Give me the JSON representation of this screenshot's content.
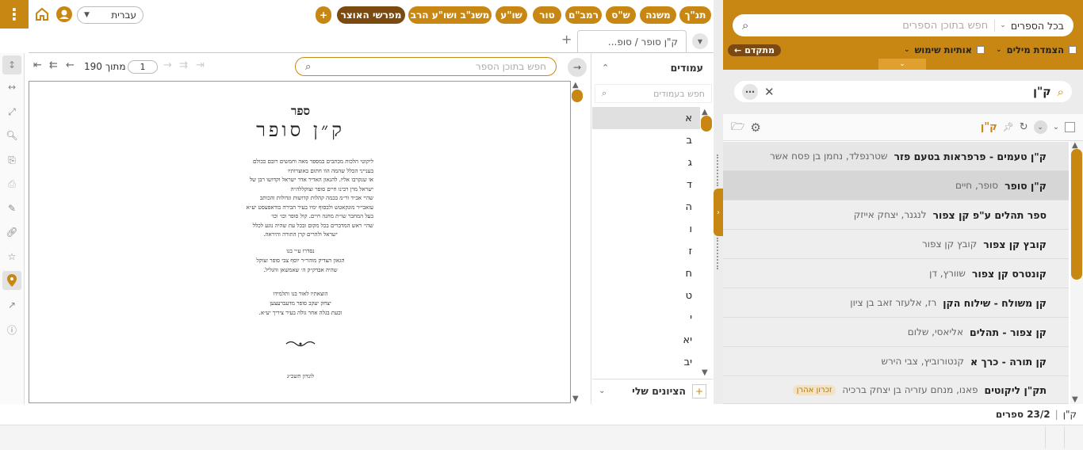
{
  "toolbar": {
    "tabs": [
      "תנ\"ך",
      "משנה",
      "ש\"ס",
      "רמב\"ם",
      "טור",
      "שו\"ע",
      "משנ\"ב ושו\"ע הרב",
      "מפרשי האוצר"
    ],
    "add": "+",
    "language": "עברית"
  },
  "doc_tab": {
    "title": "ק\"ן סופר / סופ..."
  },
  "nav": {
    "page_value": "1",
    "page_total": "מתוך 190",
    "search_placeholder": "חפש בתוכן הספר"
  },
  "pages_panel": {
    "title": "עמודים",
    "search_placeholder": "חפש בעמודים",
    "letters": [
      "א",
      "ב",
      "ג",
      "ד",
      "ה",
      "ו",
      "ז",
      "ח",
      "ט",
      "י",
      "יא",
      "יב"
    ],
    "bookmarks": "הציונים שלי"
  },
  "book_page": {
    "word_sefer": "ספר",
    "title": "ק״ן סופר",
    "p1": "ליקוטי הלכות מכתבים במספר מאה וחמשים רובם ככולם",
    "p2": "בענייני הכלל שהמה הוו חתום באוצרותיו",
    "p3": "או שנקרבו אליו. להגאון האדיר אדר ישראל וקדושו רבן של",
    "p4": "ישראל מרן רבינו חיים סופר זצוקללה״ה",
    "p5": "שהיי אב״ד ור״מ בכמה קהלות קדושות וגדולות והכותב",
    "p6": "עזאבי״ר מונקאטש ולבסוף ימיו בעיר הבירה בודאפעסט יע״א",
    "p7": "בעל המחבר שו״ת מחנה חיים. קול סופר וכו׳ וכו׳",
    "p8": "שהי׳ ראש המדברים בכל מקום ובכל עת שהיה נוגע לכלל",
    "p9": "ישראל ולהרים קרן התורה והיראה.",
    "p10": "נסדרו ע״י בנו",
    "p11": "הגאון הצדיק מוהר״ר יוסף צבי סופר זצוקל",
    "p12": "שהיה אבדק״ק ה׳ שאמשאן והגליל.",
    "p13": "הוצאתיו לאור בנו ותלמידו",
    "p14": "יצחק יעקב סופר מדעברעצען",
    "p15": "וכעת בגלה אחר גולה בעיר ציריך יע״א.",
    "p16": "לונדון תשכ״ג"
  },
  "search": {
    "scope": "בכל הספרים",
    "placeholder": "חפש בתוכן הספרים",
    "advanced": "מתקדם",
    "opt1": "הצמדת מילים",
    "opt2": "אותיות שימוש"
  },
  "filter": {
    "query": "ק\"ן",
    "list_label": "ק\"ן"
  },
  "results": [
    {
      "title": "ק\"ן טעמים - פרפראות בטעם פזר",
      "author": "שטרנפלד, נחמן בן פסח אשר",
      "tag": ""
    },
    {
      "title": "ק\"ן סופר",
      "author": "סופר, חיים",
      "tag": ""
    },
    {
      "title": "ספר תהלים ע\"פ קן צפור",
      "author": "לנגנר, יצחק אייזק",
      "tag": ""
    },
    {
      "title": "קובץ קן צפור",
      "author": "קובץ קן צפור",
      "tag": ""
    },
    {
      "title": "קונטרס קן צפור",
      "author": "שוורץ, דן",
      "tag": ""
    },
    {
      "title": "קן משולח - שילוח הקן",
      "author": "רז, אלעזר זאב בן ציון",
      "tag": ""
    },
    {
      "title": "קן צפור - תהלים",
      "author": "אליאסי, שלום",
      "tag": ""
    },
    {
      "title": "קן תורה - כרך א",
      "author": "קנטורוביץ, צבי הירש",
      "tag": ""
    },
    {
      "title": "תק\"ן ליקוטים",
      "author": "פאנו, מנחם עזריה בן יצחק ברכיה",
      "tag": "זכרון אהרן"
    }
  ],
  "footer": {
    "count": "23/2 ספרים",
    "query": "ק\"ן"
  },
  "colors": {
    "accent": "#c88712",
    "dark": "#7a4a10"
  }
}
